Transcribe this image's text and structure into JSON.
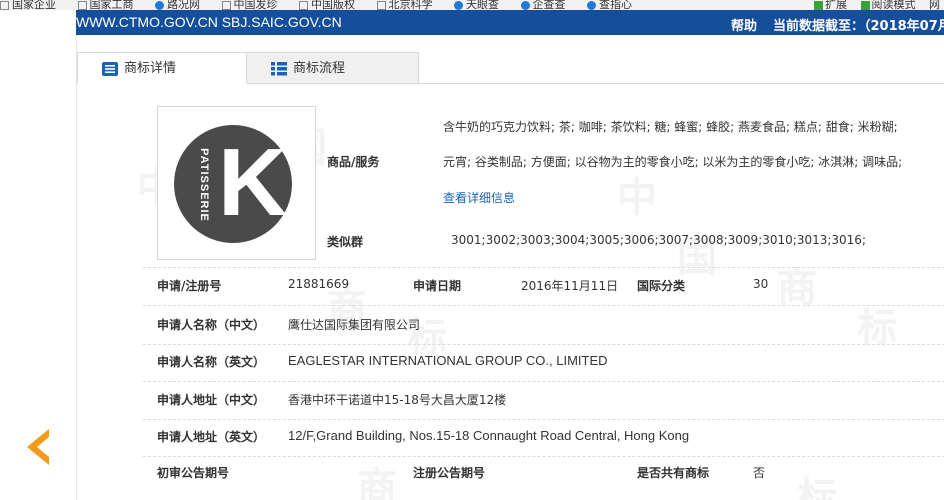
{
  "bookmarks": {
    "left_items": [
      "国家企业",
      "国家工商",
      "路况网",
      "中国发珍",
      "中国版权",
      "北京科学",
      "天眼查",
      "企查查",
      "查指心"
    ],
    "right_items": [
      "扩展",
      "阅读模式",
      "网"
    ]
  },
  "topbar": {
    "site": "WWW.CTMO.GOV.CN SBJ.SAIC.GOV.CN",
    "help": "帮助",
    "data_as_of": "当前数据截至：（2018年07月"
  },
  "tabs": [
    {
      "label": "商标详情",
      "icon": "list-icon"
    },
    {
      "label": "商标流程",
      "icon": "flow-icon"
    }
  ],
  "logo": {
    "letter": "K",
    "word": "PATISSERIE",
    "circle_color": "#4a4a4a"
  },
  "goods": {
    "label": "商品/服务",
    "line1": "含牛奶的巧克力饮料; 茶; 咖啡; 茶饮料; 糖; 蜂蜜; 蜂胶; 燕麦食品; 糕点; 甜食; 米粉糊;",
    "line2": "元宵; 谷类制品; 方便面; 以谷物为主的零食小吃; 以米为主的零食小吃; 冰淇淋; 调味品;",
    "more_link": "查看详细信息"
  },
  "similar_group": {
    "label": "类似群",
    "value": "3001;3002;3003;3004;3005;3006;3007;3008;3009;3010;3013;3016;"
  },
  "details": {
    "reg_no_label": "申请/注册号",
    "reg_no": "21881669",
    "app_date_label": "申请日期",
    "app_date": "2016年11月11日",
    "intl_class_label": "国际分类",
    "intl_class": "30",
    "applicant_cn_label": "申请人名称（中文）",
    "applicant_cn": "鹰仕达国际集团有限公司",
    "applicant_en_label": "申请人名称（英文）",
    "applicant_en": "EAGLESTAR INTERNATIONAL GROUP CO., LIMITED",
    "address_cn_label": "申请人地址（中文）",
    "address_cn": "香港中环干诺道中15-18号大昌大厦12楼",
    "address_en_label": "申请人地址（英文）",
    "address_en": "12/F,Grand Building, Nos.15-18 Connaught Road Central, Hong Kong",
    "prelim_pub_label": "初审公告期号",
    "reg_pub_label": "注册公告期号",
    "shared_label": "是否共有商标",
    "shared_value": "否"
  },
  "colors": {
    "header_blue": "#154f9b",
    "link_blue": "#1a63b5",
    "arrow_orange": "#f39a1d"
  }
}
